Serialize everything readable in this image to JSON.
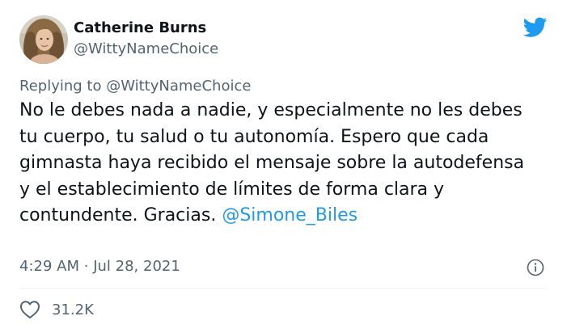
{
  "author": {
    "name": "Catherine Burns",
    "handle": "@WittyNameChoice"
  },
  "reply": {
    "prefix": "Replying to",
    "mention": "@WittyNameChoice"
  },
  "tweet": {
    "lines": [
      "No le debes nada a nadie, y especialmente no les debes",
      "tu cuerpo, tu salud o tu autonomía. Espero que cada",
      "gimnasta haya recibido el mensaje sobre la autodefensa",
      "y el establecimiento de límites de forma clara y",
      "contundente. Gracias."
    ],
    "mention_link": "@Simone_Biles"
  },
  "meta": {
    "time": "4:29 AM",
    "separator": "·",
    "date": "Jul 28, 2021"
  },
  "engagement": {
    "likes": "31.2K"
  },
  "icons": {
    "logo": "twitter-bird-icon",
    "info": "info-icon",
    "like": "heart-icon"
  },
  "colors": {
    "link": "#1d9bf0",
    "secondary_text": "#536471",
    "primary_text": "#0f1419"
  }
}
